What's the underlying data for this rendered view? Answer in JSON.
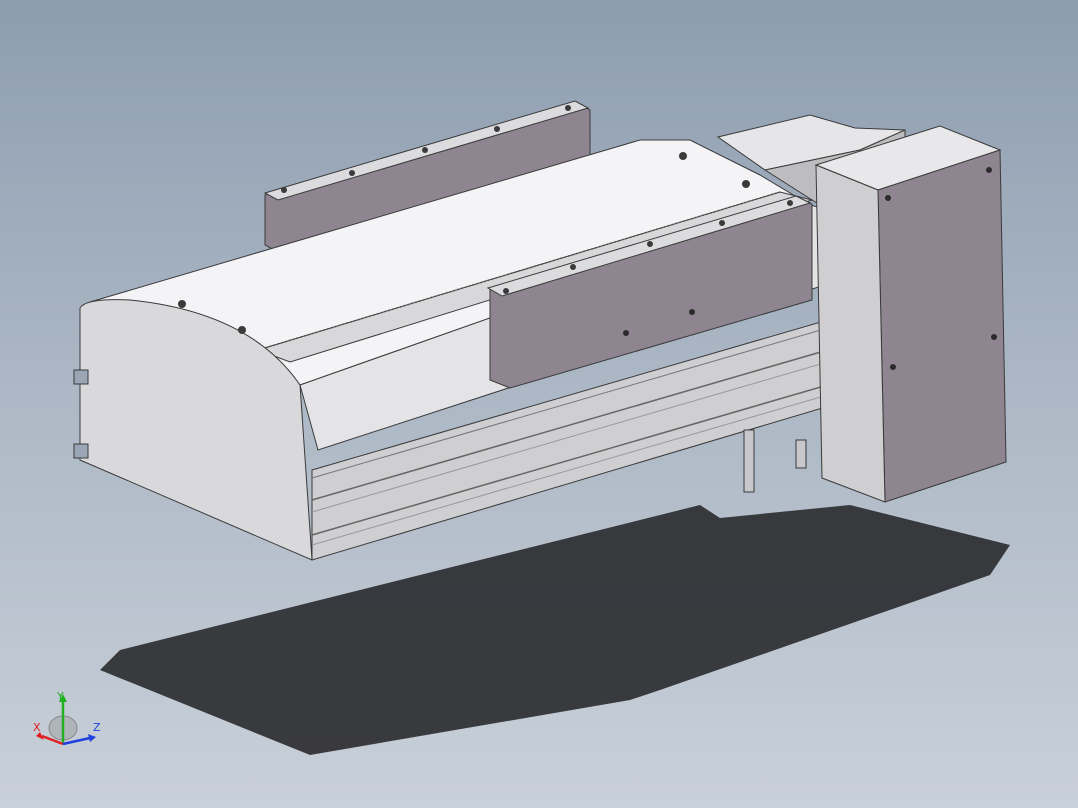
{
  "viewport": {
    "background_top": "#8d9db0",
    "background_bottom": "#c9d0d9"
  },
  "model": {
    "body_color": "#f4f4f6",
    "side_color": "#d9d9db",
    "plate_color": "#8e8590",
    "motor_color": "#cfcfd1",
    "shadow_color": "#2a2a2e"
  },
  "triad": {
    "x_label": "X",
    "y_label": "Y",
    "z_label": "Z",
    "x_color": "#e02020",
    "y_color": "#20b020",
    "z_color": "#2040e0"
  }
}
